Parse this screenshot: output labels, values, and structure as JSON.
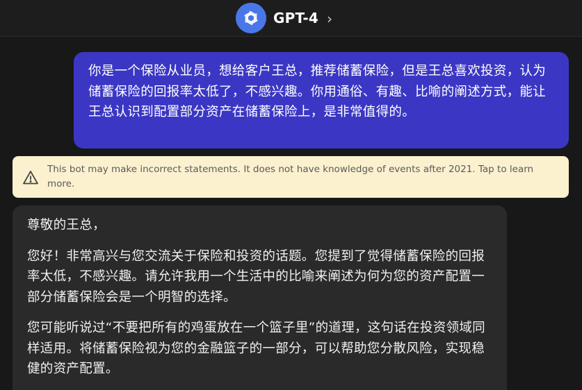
{
  "header": {
    "title": "GPT-4",
    "avatar_icon": "openai-logo-icon",
    "chevron_icon": "chevron-right-icon",
    "avatar_color": "#4a77e8"
  },
  "user_message": {
    "text": "你是一个保险从业员，想给客户王总，推荐储蓄保险，但是王总喜欢投资，认为储蓄保险的回报率太低了，不感兴趣。你用通俗、有趣、比喻的阐述方式，能让王总认识到配置部分资产在储蓄保险上，是非常值得的。",
    "bubble_color": "#3b37c4"
  },
  "warning": {
    "icon": "warning-triangle-icon",
    "text": "This bot may make incorrect statements. It does not have knowledge of events after 2021. Tap to learn more."
  },
  "bot_message": {
    "paragraphs": [
      "尊敬的王总，",
      "您好！非常高兴与您交流关于保险和投资的话题。您提到了觉得储蓄保险的回报率太低，不感兴趣。请允许我用一个生活中的比喻来阐述为何为您的资产配置一部分储蓄保险会是一个明智的选择。",
      "您可能听说过“不要把所有的鸡蛋放在一个篮子里”的道理，这句话在投资领域同样适用。将储蓄保险视为您的金融篮子的一部分，可以帮助您分散风险，实现稳健的资产配置。"
    ]
  }
}
